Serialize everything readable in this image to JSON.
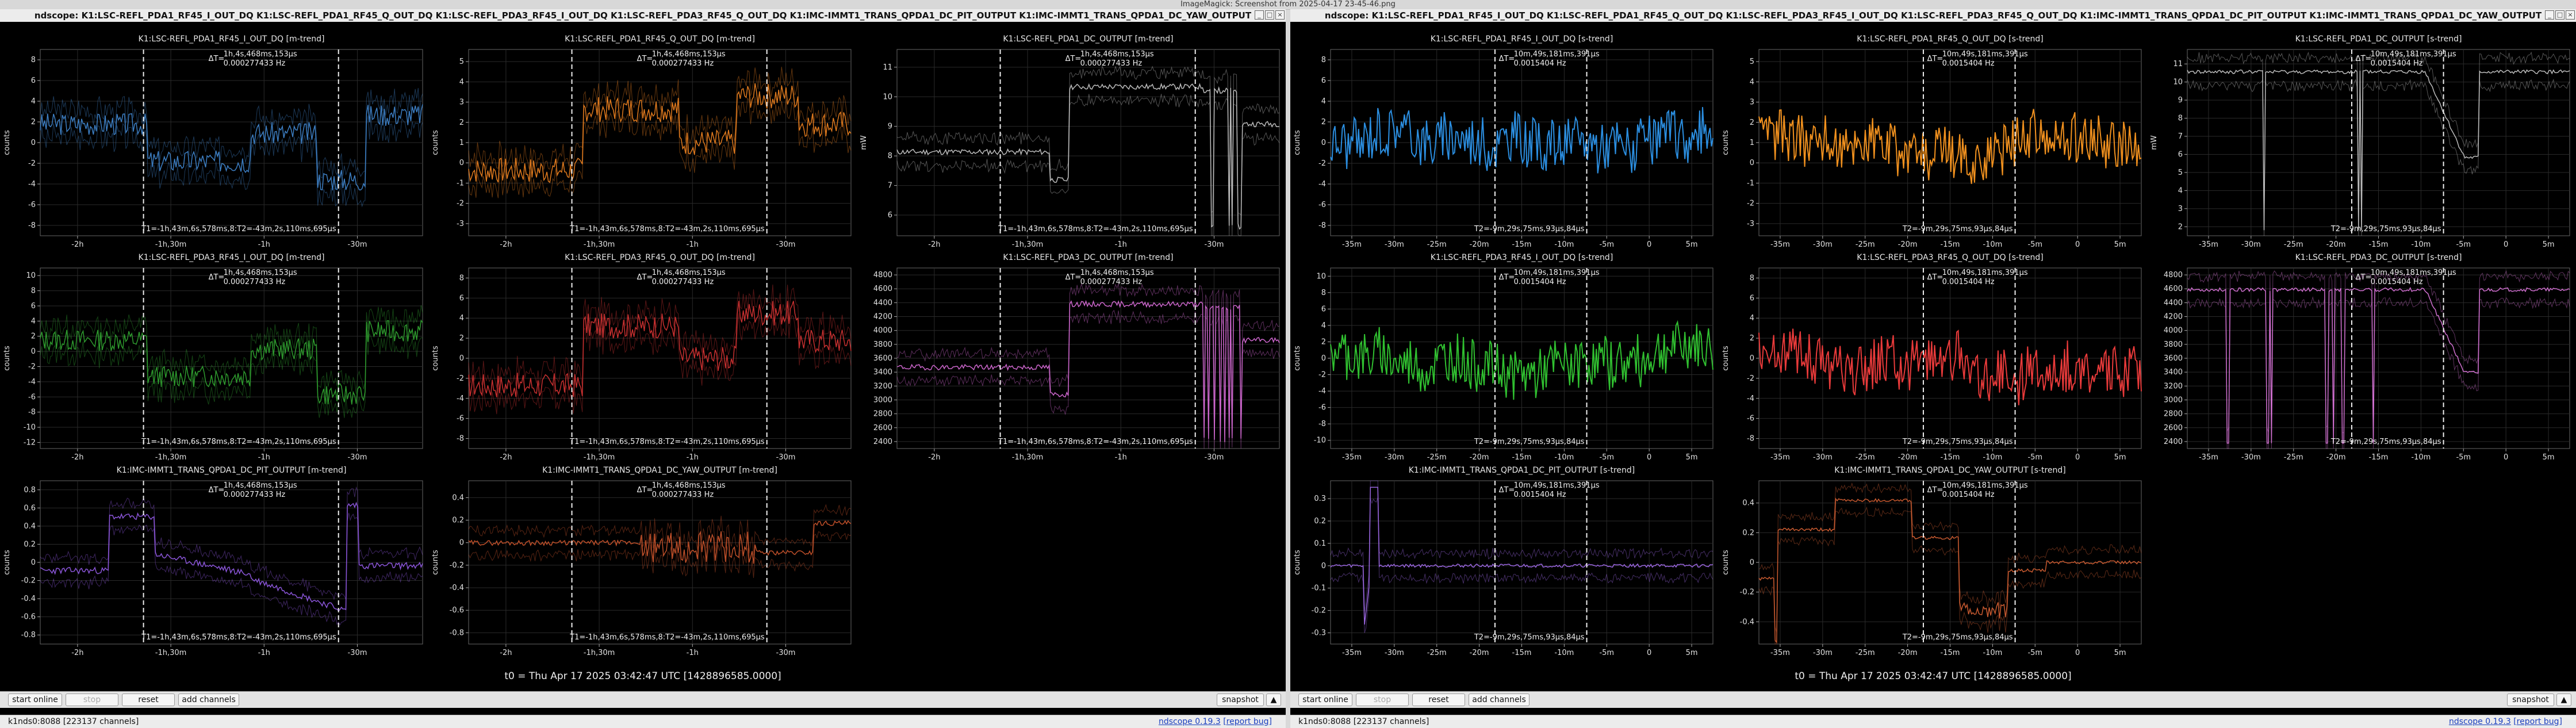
{
  "screen_title": "ImageMagick: Screenshot from 2025-04-17 23-45-46.png",
  "windows": [
    {
      "id": "L",
      "title": "ndscope: K1:LSC-REFL_PDA1_RF45_I_OUT_DQ K1:LSC-REFL_PDA1_RF45_Q_OUT_DQ K1:LSC-REFL_PDA3_RF45_I_OUT_DQ K1:LSC-REFL_PDA3_RF45_Q_OUT_DQ K1:IMC-IMMT1_TRANS_QPDA1_DC_PIT_OUTPUT K1:IMC-IMMT1_TRANS_QPDA1_DC_YAW_OUTPUT",
      "t0_text": "t0 = Thu Apr 17 2025 03:42:47 UTC [1428896585.0000]",
      "buttons": {
        "start_online": "start online",
        "stop": "stop",
        "reset": "reset",
        "add_channels": "add channels",
        "snapshot": "snapshot"
      },
      "status_left": "k1nds0:8088 [223137 channels]",
      "status_version": "ndscope 0.19.3",
      "status_report": "[report bug]",
      "plots": [
        {
          "title": "K1:LSC-REFL_PDA1_RF45_I_OUT_DQ [m-trend]",
          "ylabel": "counts",
          "yticks": [
            "-8",
            "-6",
            "-4",
            "-2",
            "0",
            "2",
            "4",
            "6",
            "8"
          ],
          "ymin": -9,
          "ymax": 9,
          "xticks": [
            "-2h",
            "-1h,30m",
            "-1h",
            "-30m"
          ],
          "color": "#3d7fc4",
          "delta_label": "ΔT=",
          "delta_value": "1h,4s,468ms,153µs",
          "freq": "0.000277433 Hz",
          "cursor_text": "T1=-1h,43m,6s,578ms,8:T2=-43m,2s,110ms,695µs",
          "shape": "steps1",
          "seed": 3
        },
        {
          "title": "K1:LSC-REFL_PDA1_RF45_Q_OUT_DQ [m-trend]",
          "ylabel": "counts",
          "yticks": [
            "-3",
            "-2",
            "-1",
            "0",
            "1",
            "2",
            "3",
            "4",
            "5"
          ],
          "ymin": -3.6,
          "ymax": 5.6,
          "xticks": [
            "-2h",
            "-1h,30m",
            "-1h",
            "-30m"
          ],
          "color": "#e07a1e",
          "delta_label": "ΔT=",
          "delta_value": "1h,4s,468ms,153µs",
          "freq": "0.000277433 Hz",
          "cursor_text": "T1=-1h,43m,6s,578ms,8:T2=-43m,2s,110ms,695µs",
          "shape": "steps2",
          "seed": 7
        },
        {
          "title": "K1:LSC-REFL_PDA1_DC_OUTPUT [m-trend]",
          "ylabel": "mW",
          "yticks": [
            "6",
            "7",
            "8",
            "9",
            "10",
            "11"
          ],
          "ymin": 5.3,
          "ymax": 11.6,
          "xticks": [
            "-2h",
            "-1h,30m",
            "-1h",
            "-30m"
          ],
          "color": "#bbbbbb",
          "delta_label": "ΔT=",
          "delta_value": "1h,4s,468ms,153µs",
          "freq": "0.000277433 Hz",
          "cursor_text": "T1=-1h,43m,6s,578ms,8:T2=-43m,2s,110ms,695µs",
          "shape": "dc",
          "seed": 11
        },
        {
          "title": "K1:LSC-REFL_PDA3_RF45_I_OUT_DQ [m-trend]",
          "ylabel": "counts",
          "yticks": [
            "-12",
            "-10",
            "-8",
            "-6",
            "-4",
            "-2",
            "0",
            "2",
            "4",
            "6",
            "8",
            "10"
          ],
          "ymin": -12.8,
          "ymax": 11,
          "xticks": [
            "-2h",
            "-1h,30m",
            "-1h",
            "-30m"
          ],
          "color": "#2e9b2e",
          "delta_label": "ΔT=",
          "delta_value": "1h,4s,468ms,153µs",
          "freq": "0.000277433 Hz",
          "cursor_text": "T1=-1h,43m,6s,578ms,8:T2=-43m,2s,110ms,695µs",
          "shape": "steps1",
          "seed": 13
        },
        {
          "title": "K1:LSC-REFL_PDA3_RF45_Q_OUT_DQ [m-trend]",
          "ylabel": "counts",
          "yticks": [
            "-8",
            "-6",
            "-4",
            "-2",
            "0",
            "2",
            "4",
            "6",
            "8"
          ],
          "ymin": -9,
          "ymax": 9,
          "xticks": [
            "-2h",
            "-1h,30m",
            "-1h",
            "-30m"
          ],
          "color": "#c83030",
          "delta_label": "ΔT=",
          "delta_value": "1h,4s,468ms,153µs",
          "freq": "0.000277433 Hz",
          "cursor_text": "T1=-1h,43m,6s,578ms,8:T2=-43m,2s,110ms,695µs",
          "shape": "steps2",
          "seed": 17
        },
        {
          "title": "K1:LSC-REFL_PDA3_DC_OUTPUT [m-trend]",
          "ylabel": "",
          "yticks": [
            "2400",
            "2600",
            "2800",
            "3000",
            "3200",
            "3400",
            "3600",
            "3800",
            "4000",
            "4200",
            "4400",
            "4600",
            "4800"
          ],
          "ymin": 2300,
          "ymax": 4900,
          "xticks": [
            "-2h",
            "-1h,30m",
            "-1h",
            "-30m"
          ],
          "color": "#cc66cc",
          "delta_label": "ΔT=",
          "delta_value": "1h,4s,468ms,153µs",
          "freq": "0.000277433 Hz",
          "cursor_text": "T1=-1h,43m,6s,578ms,8:T2=-43m,2s,110ms,695µs",
          "shape": "dc",
          "seed": 19
        },
        {
          "title": "K1:IMC-IMMT1_TRANS_QPDA1_DC_PIT_OUTPUT [m-trend]",
          "ylabel": "counts",
          "yticks": [
            "-0.8",
            "-0.6",
            "-0.4",
            "-0.2",
            "0",
            "0.2",
            "0.4",
            "0.6",
            "0.8"
          ],
          "ymin": -0.9,
          "ymax": 0.9,
          "xticks": [
            "-2h",
            "-1h,30m",
            "-1h",
            "-30m"
          ],
          "color": "#8a55d8",
          "delta_label": "ΔT=",
          "delta_value": "1h,4s,468ms,153µs",
          "freq": "0.000277433 Hz",
          "cursor_text": "T1=-1h,43m,6s,578ms,8:T2=-43m,2s,110ms,695µs",
          "shape": "pit",
          "seed": 23
        },
        {
          "title": "K1:IMC-IMMT1_TRANS_QPDA1_DC_YAW_OUTPUT [m-trend]",
          "ylabel": "counts",
          "yticks": [
            "-0.8",
            "-0.6",
            "-0.4",
            "-0.2",
            "0",
            "0.2",
            "0.4"
          ],
          "ymin": -0.9,
          "ymax": 0.55,
          "xticks": [
            "-2h",
            "-1h,30m",
            "-1h",
            "-30m"
          ],
          "color": "#c0502a",
          "delta_label": "ΔT=",
          "delta_value": "1h,4s,468ms,153µs",
          "freq": "0.000277433 Hz",
          "cursor_text": "T1=-1h,43m,6s,578ms,8:T2=-43m,2s,110ms,695µs",
          "shape": "yaw",
          "seed": 29
        }
      ]
    },
    {
      "id": "R",
      "title": "ndscope: K1:LSC-REFL_PDA1_RF45_I_OUT_DQ K1:LSC-REFL_PDA1_RF45_Q_OUT_DQ K1:LSC-REFL_PDA3_RF45_I_OUT_DQ K1:LSC-REFL_PDA3_RF45_Q_OUT_DQ K1:IMC-IMMT1_TRANS_QPDA1_DC_PIT_OUTPUT K1:IMC-IMMT1_TRANS_QPDA1_DC_YAW_OUTPUT",
      "t0_text": "t0 = Thu Apr 17 2025 03:42:47 UTC [1428896585.0000]",
      "buttons": {
        "start_online": "start online",
        "stop": "stop",
        "reset": "reset",
        "add_channels": "add channels",
        "snapshot": "snapshot"
      },
      "status_left": "k1nds0:8088 [223137 channels]",
      "status_version": "ndscope 0.19.3",
      "status_report": "[report bug]",
      "plots": [
        {
          "title": "K1:LSC-REFL_PDA1_RF45_I_OUT_DQ [s-trend]",
          "ylabel": "counts",
          "yticks": [
            "-8",
            "-6",
            "-4",
            "-2",
            "0",
            "2",
            "4",
            "6",
            "8"
          ],
          "ymin": -9,
          "ymax": 9,
          "xticks": [
            "-35m",
            "-30m",
            "-25m",
            "-20m",
            "-15m",
            "-10m",
            "-5m",
            "0",
            "5m"
          ],
          "color": "#2b8ee0",
          "delta_label": "ΔT=",
          "delta_value": "10m,49s,181ms,391µs",
          "freq": "0.0015404 Hz",
          "cursor_text": "T2=-9m,29s,75ms,93µs,84µs",
          "shape": "noisy",
          "seed": 31
        },
        {
          "title": "K1:LSC-REFL_PDA1_RF45_Q_OUT_DQ [s-trend]",
          "ylabel": "counts",
          "yticks": [
            "-3",
            "-2",
            "-1",
            "0",
            "1",
            "2",
            "3",
            "4",
            "5"
          ],
          "ymin": -3.6,
          "ymax": 5.6,
          "xticks": [
            "-35m",
            "-30m",
            "-25m",
            "-20m",
            "-15m",
            "-10m",
            "-5m",
            "0",
            "5m"
          ],
          "color": "#f0901e",
          "delta_label": "ΔT=",
          "delta_value": "10m,49s,181ms,391µs",
          "freq": "0.0015404 Hz",
          "cursor_text": "T2=-9m,29s,75ms,93µs,84µs",
          "shape": "noisy",
          "seed": 37
        },
        {
          "title": "K1:LSC-REFL_PDA1_DC_OUTPUT [s-trend]",
          "ylabel": "mW",
          "yticks": [
            "2",
            "3",
            "4",
            "5",
            "6",
            "7",
            "8",
            "9",
            "10",
            "11"
          ],
          "ymin": 1.5,
          "ymax": 11.8,
          "xticks": [
            "-35m",
            "-30m",
            "-25m",
            "-20m",
            "-15m",
            "-10m",
            "-5m",
            "0",
            "5m"
          ],
          "color": "#bbbbbb",
          "delta_label": "ΔT=",
          "delta_value": "10m,49s,181ms,391µs",
          "freq": "0.0015404 Hz",
          "cursor_text": "T2=-9m,29s,75ms,93µs,84µs",
          "shape": "dcdrop",
          "seed": 41
        },
        {
          "title": "K1:LSC-REFL_PDA3_RF45_I_OUT_DQ [s-trend]",
          "ylabel": "counts",
          "yticks": [
            "-10",
            "-8",
            "-6",
            "-4",
            "-2",
            "0",
            "2",
            "4",
            "6",
            "8",
            "10"
          ],
          "ymin": -11,
          "ymax": 11,
          "xticks": [
            "-35m",
            "-30m",
            "-25m",
            "-20m",
            "-15m",
            "-10m",
            "-5m",
            "0",
            "5m"
          ],
          "color": "#30c030",
          "delta_label": "ΔT=",
          "delta_value": "10m,49s,181ms,391µs",
          "freq": "0.0015404 Hz",
          "cursor_text": "T2=-9m,29s,75ms,93µs,84µs",
          "shape": "noisy",
          "seed": 43
        },
        {
          "title": "K1:LSC-REFL_PDA3_RF45_Q_OUT_DQ [s-trend]",
          "ylabel": "counts",
          "yticks": [
            "-8",
            "-6",
            "-4",
            "-2",
            "0",
            "2",
            "4",
            "6",
            "8"
          ],
          "ymin": -9,
          "ymax": 9,
          "xticks": [
            "-35m",
            "-30m",
            "-25m",
            "-20m",
            "-15m",
            "-10m",
            "-5m",
            "0",
            "5m"
          ],
          "color": "#e83a3a",
          "delta_label": "ΔT=",
          "delta_value": "10m,49s,181ms,391µs",
          "freq": "0.0015404 Hz",
          "cursor_text": "T2=-9m,29s,75ms,93µs,84µs",
          "shape": "noisy",
          "seed": 47
        },
        {
          "title": "K1:LSC-REFL_PDA3_DC_OUTPUT [s-trend]",
          "ylabel": "",
          "yticks": [
            "2400",
            "2600",
            "2800",
            "3000",
            "3200",
            "3400",
            "3600",
            "3800",
            "4000",
            "4200",
            "4400",
            "4600",
            "4800"
          ],
          "ymin": 2300,
          "ymax": 4900,
          "xticks": [
            "-35m",
            "-30m",
            "-25m",
            "-20m",
            "-15m",
            "-10m",
            "-5m",
            "0",
            "5m"
          ],
          "color": "#d070d0",
          "delta_label": "ΔT=",
          "delta_value": "10m,49s,181ms,391µs",
          "freq": "0.0015404 Hz",
          "cursor_text": "T2=-9m,29s,75ms,93µs,84µs",
          "shape": "dcdrop",
          "seed": 53
        },
        {
          "title": "K1:IMC-IMMT1_TRANS_QPDA1_DC_PIT_OUTPUT [s-trend]",
          "ylabel": "counts",
          "yticks": [
            "-0.3",
            "-0.2",
            "-0.1",
            "0",
            "0.1",
            "0.2",
            "0.3"
          ],
          "ymin": -0.35,
          "ymax": 0.38,
          "xticks": [
            "-35m",
            "-30m",
            "-25m",
            "-20m",
            "-15m",
            "-10m",
            "-5m",
            "0",
            "5m"
          ],
          "color": "#9a66e0",
          "delta_label": "ΔT=",
          "delta_value": "10m,49s,181ms,391µs",
          "freq": "0.0015404 Hz",
          "cursor_text": "T2=-9m,29s,75ms,93µs,84µs",
          "shape": "spike",
          "seed": 59
        },
        {
          "title": "K1:IMC-IMMT1_TRANS_QPDA1_DC_YAW_OUTPUT [s-trend]",
          "ylabel": "counts",
          "yticks": [
            "-0.4",
            "-0.2",
            "0",
            "0.2",
            "0.4"
          ],
          "ymin": -0.55,
          "ymax": 0.55,
          "xticks": [
            "-35m",
            "-30m",
            "-25m",
            "-20m",
            "-15m",
            "-10m",
            "-5m",
            "0",
            "5m"
          ],
          "color": "#c85a30",
          "delta_label": "ΔT=",
          "delta_value": "10m,49s,181ms,391µs",
          "freq": "0.0015404 Hz",
          "cursor_text": "T2=-9m,29s,75ms,93µs,84µs",
          "shape": "yawS",
          "seed": 61
        }
      ]
    }
  ]
}
